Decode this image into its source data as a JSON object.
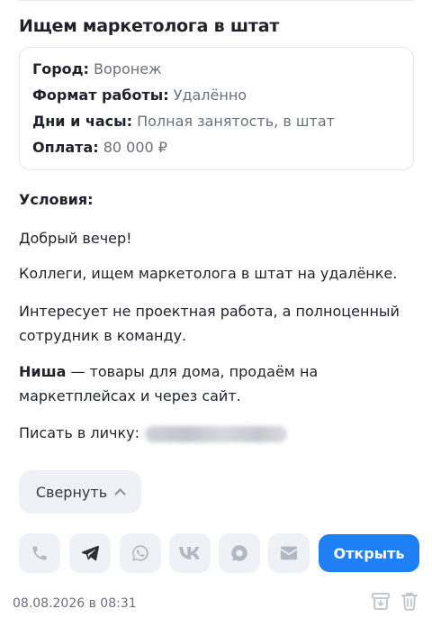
{
  "post": {
    "title": "Ищем маркетолога в штат",
    "info": [
      {
        "label": "Город:",
        "value": "Воронеж"
      },
      {
        "label": "Формат работы:",
        "value": "Удалённо"
      },
      {
        "label": "Дни и часы:",
        "value": "Полная занятость, в штат"
      },
      {
        "label": "Оплата:",
        "value": "80 000 ₽"
      }
    ],
    "conditions_heading": "Условия:",
    "greeting": "Добрый вечер!",
    "intro": "Коллеги, ищем маркетолога в штат на удалёнке.",
    "interest": "Интересует не проектная работа, а полноценный сотрудник в команду.",
    "niche_label": "Ниша",
    "niche_text": " — товары для дома, продаём на маркетплейсах и через сайт.",
    "contact_label": "Писать в личку:"
  },
  "actions": {
    "collapse_label": "Свернуть",
    "open_label": "Открыть",
    "contact_icons": [
      "phone-icon",
      "telegram-icon",
      "whatsapp-icon",
      "vk-icon",
      "max-messenger-icon",
      "email-icon"
    ]
  },
  "footer": {
    "date": "08.08.2026 в 08:31"
  },
  "colors": {
    "accent": "#1f7ff5",
    "button_bg": "#eef1f5",
    "muted_text": "#6a717a"
  }
}
